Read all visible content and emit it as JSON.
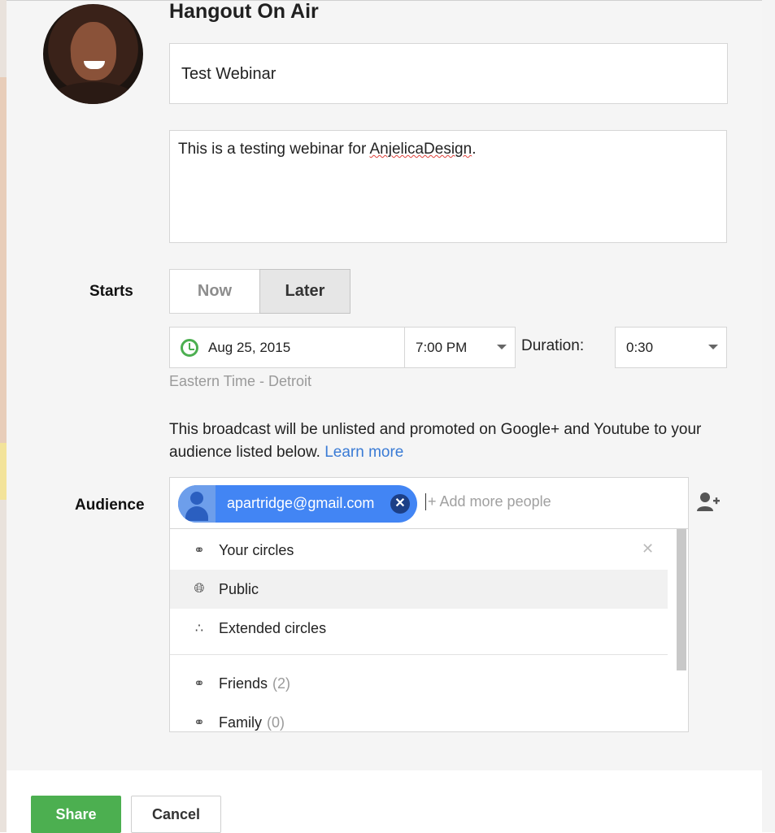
{
  "dialog": {
    "title": "Hangout On Air",
    "event_title_value": "Test Webinar",
    "description_before": "This is a testing webinar for ",
    "description_misspelled": "AnjelicaDesign",
    "description_after": "."
  },
  "starts": {
    "label": "Starts",
    "now_label": "Now",
    "later_label": "Later",
    "date": "Aug 25, 2015",
    "time": "7:00 PM",
    "duration_label": "Duration:",
    "duration_value": "0:30",
    "timezone": "Eastern Time - Detroit"
  },
  "notice": {
    "text": "This broadcast will be unlisted and promoted on Google+ and Youtube to your audience listed below.",
    "link": "Learn more"
  },
  "audience": {
    "label": "Audience",
    "chip_email": "apartridge@gmail.com",
    "chip_close": "✕",
    "add_placeholder": "+ Add more people",
    "dropdown_items": [
      {
        "label": "Your circles",
        "icon": "circles-icon",
        "count": ""
      },
      {
        "label": "Public",
        "icon": "globe-icon",
        "count": ""
      },
      {
        "label": "Extended circles",
        "icon": "extended-circles-icon",
        "count": ""
      },
      {
        "label": "Friends",
        "icon": "circles-icon",
        "count": "(2)"
      },
      {
        "label": "Family",
        "icon": "circles-icon",
        "count": "(0)"
      }
    ]
  },
  "footer": {
    "share_label": "Share",
    "cancel_label": "Cancel"
  },
  "colors": {
    "share_green": "#4caf50",
    "chip_blue": "#4285f4",
    "link_blue": "#3a7bd5"
  }
}
